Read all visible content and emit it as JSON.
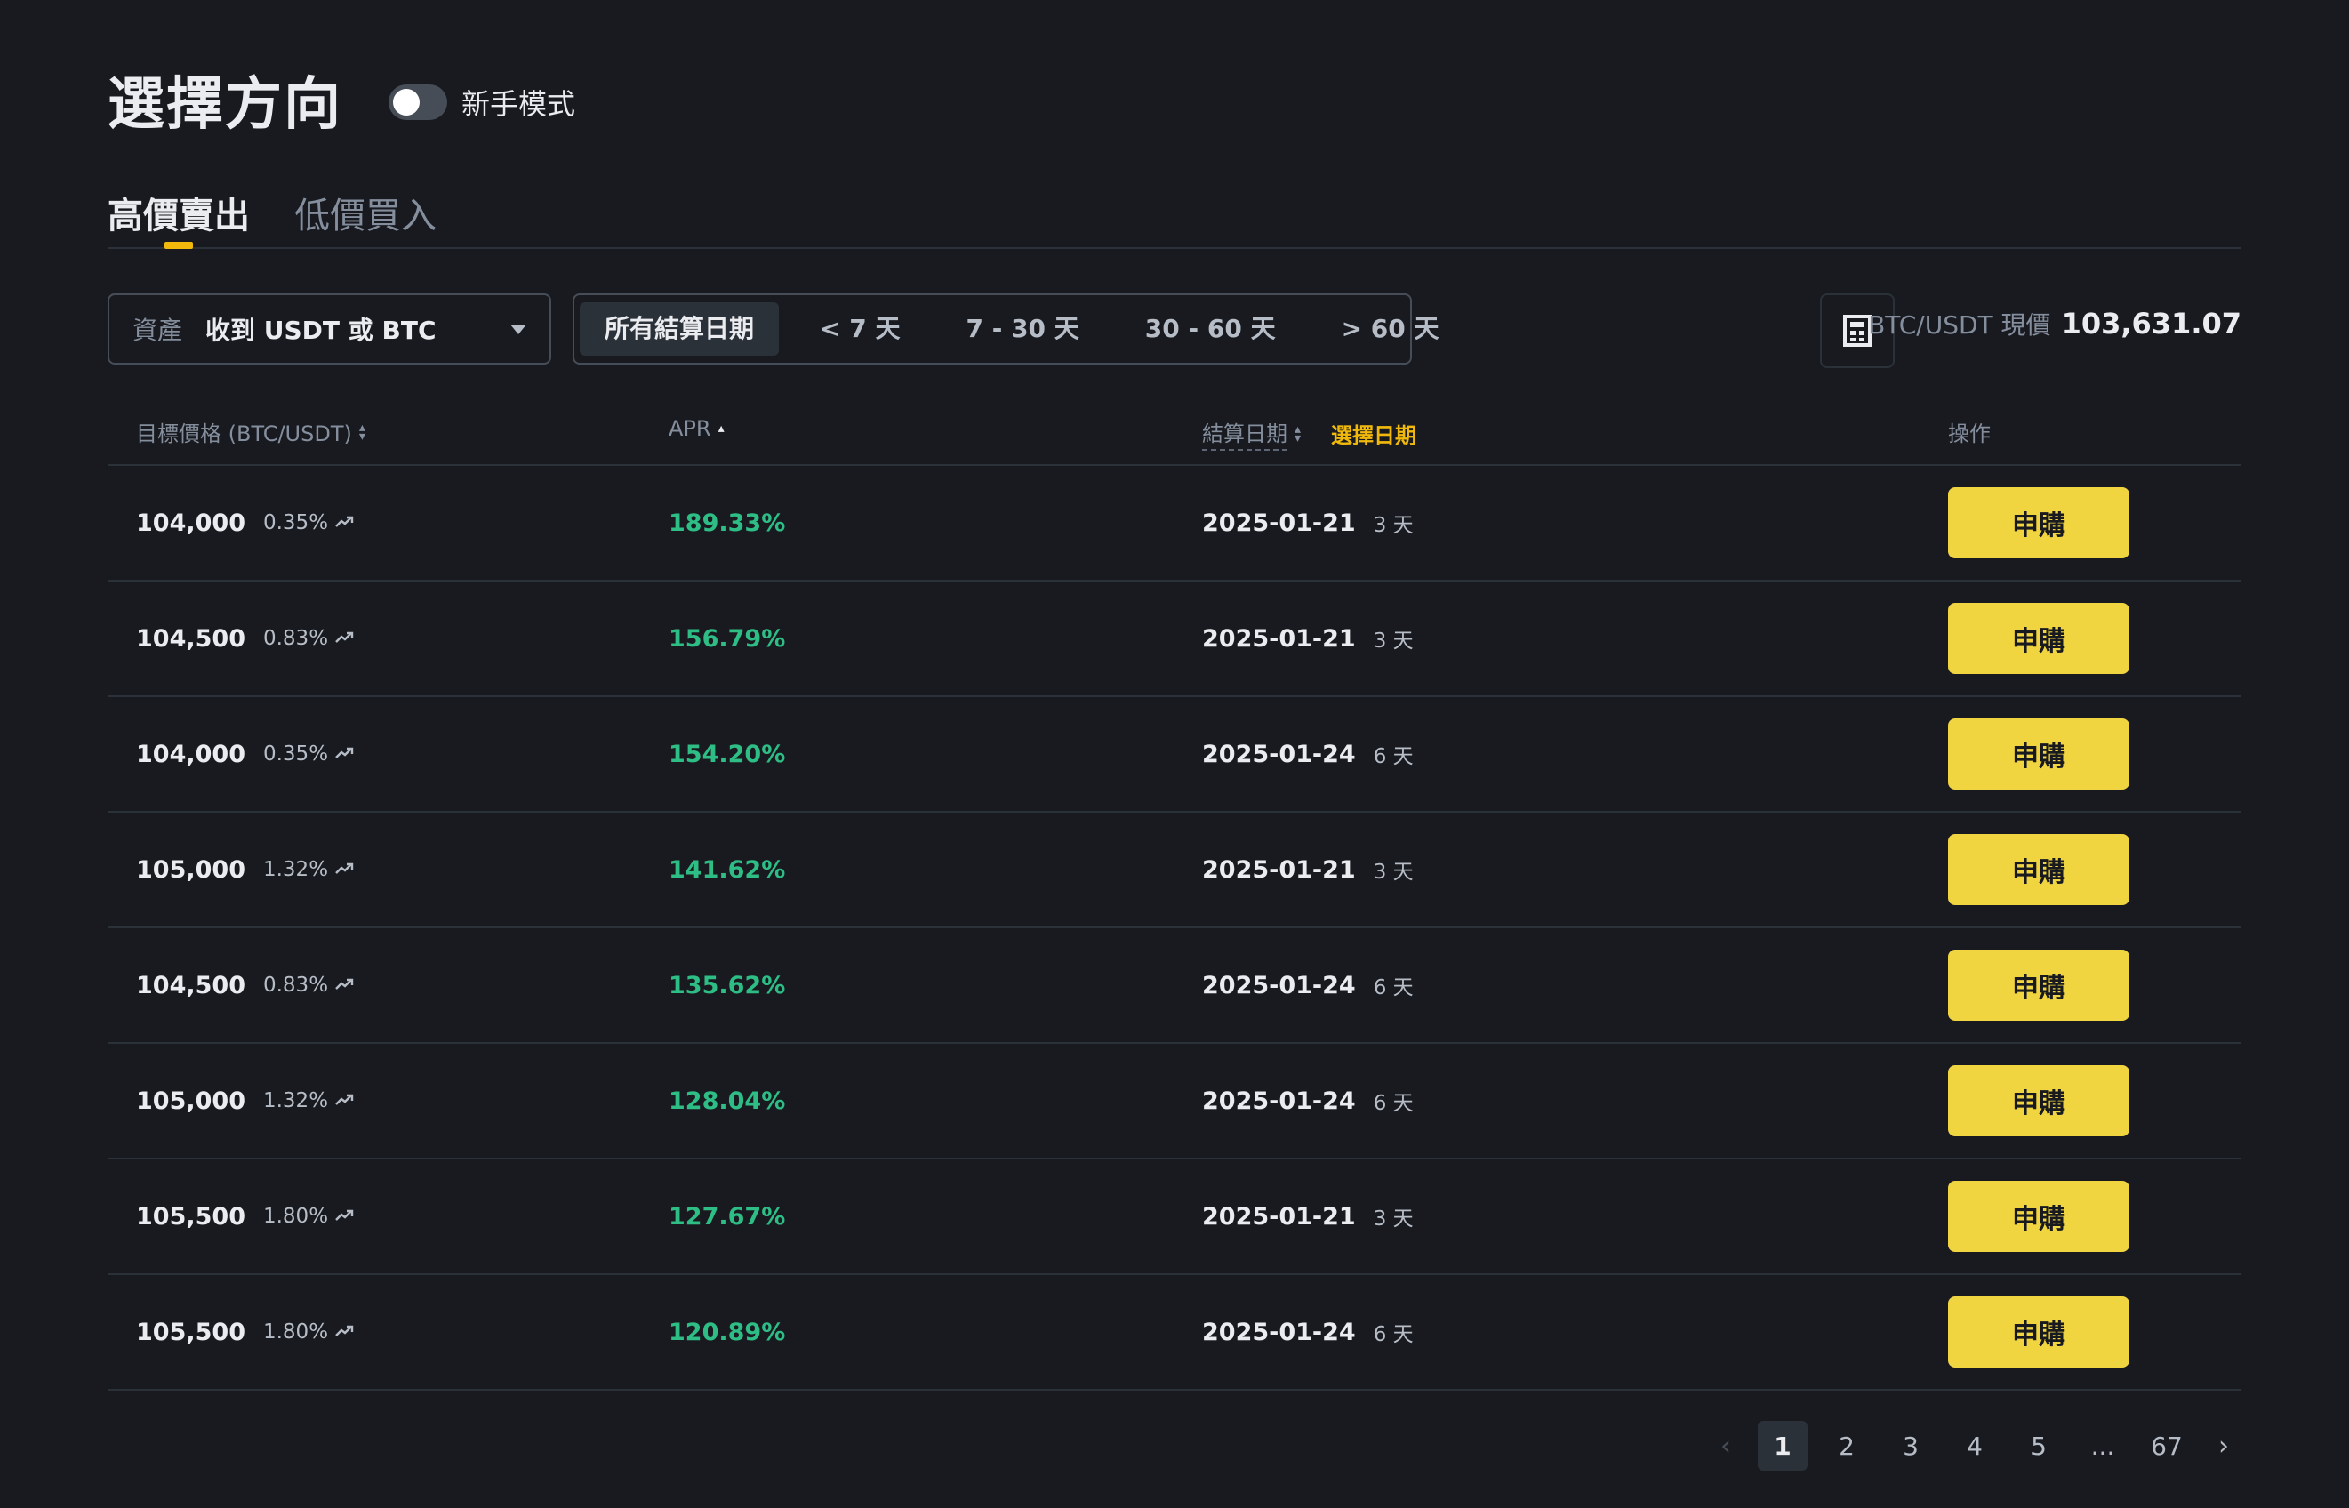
{
  "header": {
    "title": "選擇方向",
    "mode_label": "新手模式",
    "mode_on": false
  },
  "tabs": [
    {
      "label": "高價賣出",
      "active": true
    },
    {
      "label": "低價買入",
      "active": false
    }
  ],
  "filters": {
    "asset_label": "資產",
    "asset_value": "收到 USDT 或 BTC",
    "date_options": [
      {
        "label": "所有結算日期",
        "active": true
      },
      {
        "label": "< 7 天",
        "active": false
      },
      {
        "label": "7 - 30 天",
        "active": false
      },
      {
        "label": "30 - 60 天",
        "active": false
      },
      {
        "label": "> 60 天",
        "active": false
      }
    ],
    "calculator_icon": "calculator-icon",
    "price_label": "BTC/USDT 現價",
    "price_value": "103,631.07"
  },
  "table": {
    "headers": {
      "target": "目標價格 (BTC/USDT)",
      "apr": "APR",
      "settle": "結算日期",
      "choose_date": "選擇日期",
      "action": "操作"
    },
    "rows": [
      {
        "target": "104,000",
        "pct": "0.35%",
        "apr": "189.33%",
        "date": "2025-01-21",
        "days": "3 天",
        "action": "申購"
      },
      {
        "target": "104,500",
        "pct": "0.83%",
        "apr": "156.79%",
        "date": "2025-01-21",
        "days": "3 天",
        "action": "申購"
      },
      {
        "target": "104,000",
        "pct": "0.35%",
        "apr": "154.20%",
        "date": "2025-01-24",
        "days": "6 天",
        "action": "申購"
      },
      {
        "target": "105,000",
        "pct": "1.32%",
        "apr": "141.62%",
        "date": "2025-01-21",
        "days": "3 天",
        "action": "申購"
      },
      {
        "target": "104,500",
        "pct": "0.83%",
        "apr": "135.62%",
        "date": "2025-01-24",
        "days": "6 天",
        "action": "申購"
      },
      {
        "target": "105,000",
        "pct": "1.32%",
        "apr": "128.04%",
        "date": "2025-01-24",
        "days": "6 天",
        "action": "申購"
      },
      {
        "target": "105,500",
        "pct": "1.80%",
        "apr": "127.67%",
        "date": "2025-01-21",
        "days": "3 天",
        "action": "申購"
      },
      {
        "target": "105,500",
        "pct": "1.80%",
        "apr": "120.89%",
        "date": "2025-01-24",
        "days": "6 天",
        "action": "申購"
      }
    ]
  },
  "pagination": {
    "prev": "‹",
    "pages": [
      "1",
      "2",
      "3",
      "4",
      "5",
      "...",
      "67"
    ],
    "current": "1",
    "next": "›"
  },
  "colors": {
    "background": "#181a20",
    "accent": "#f0b90b",
    "button": "#f0d440",
    "positive": "#2ebd85"
  }
}
